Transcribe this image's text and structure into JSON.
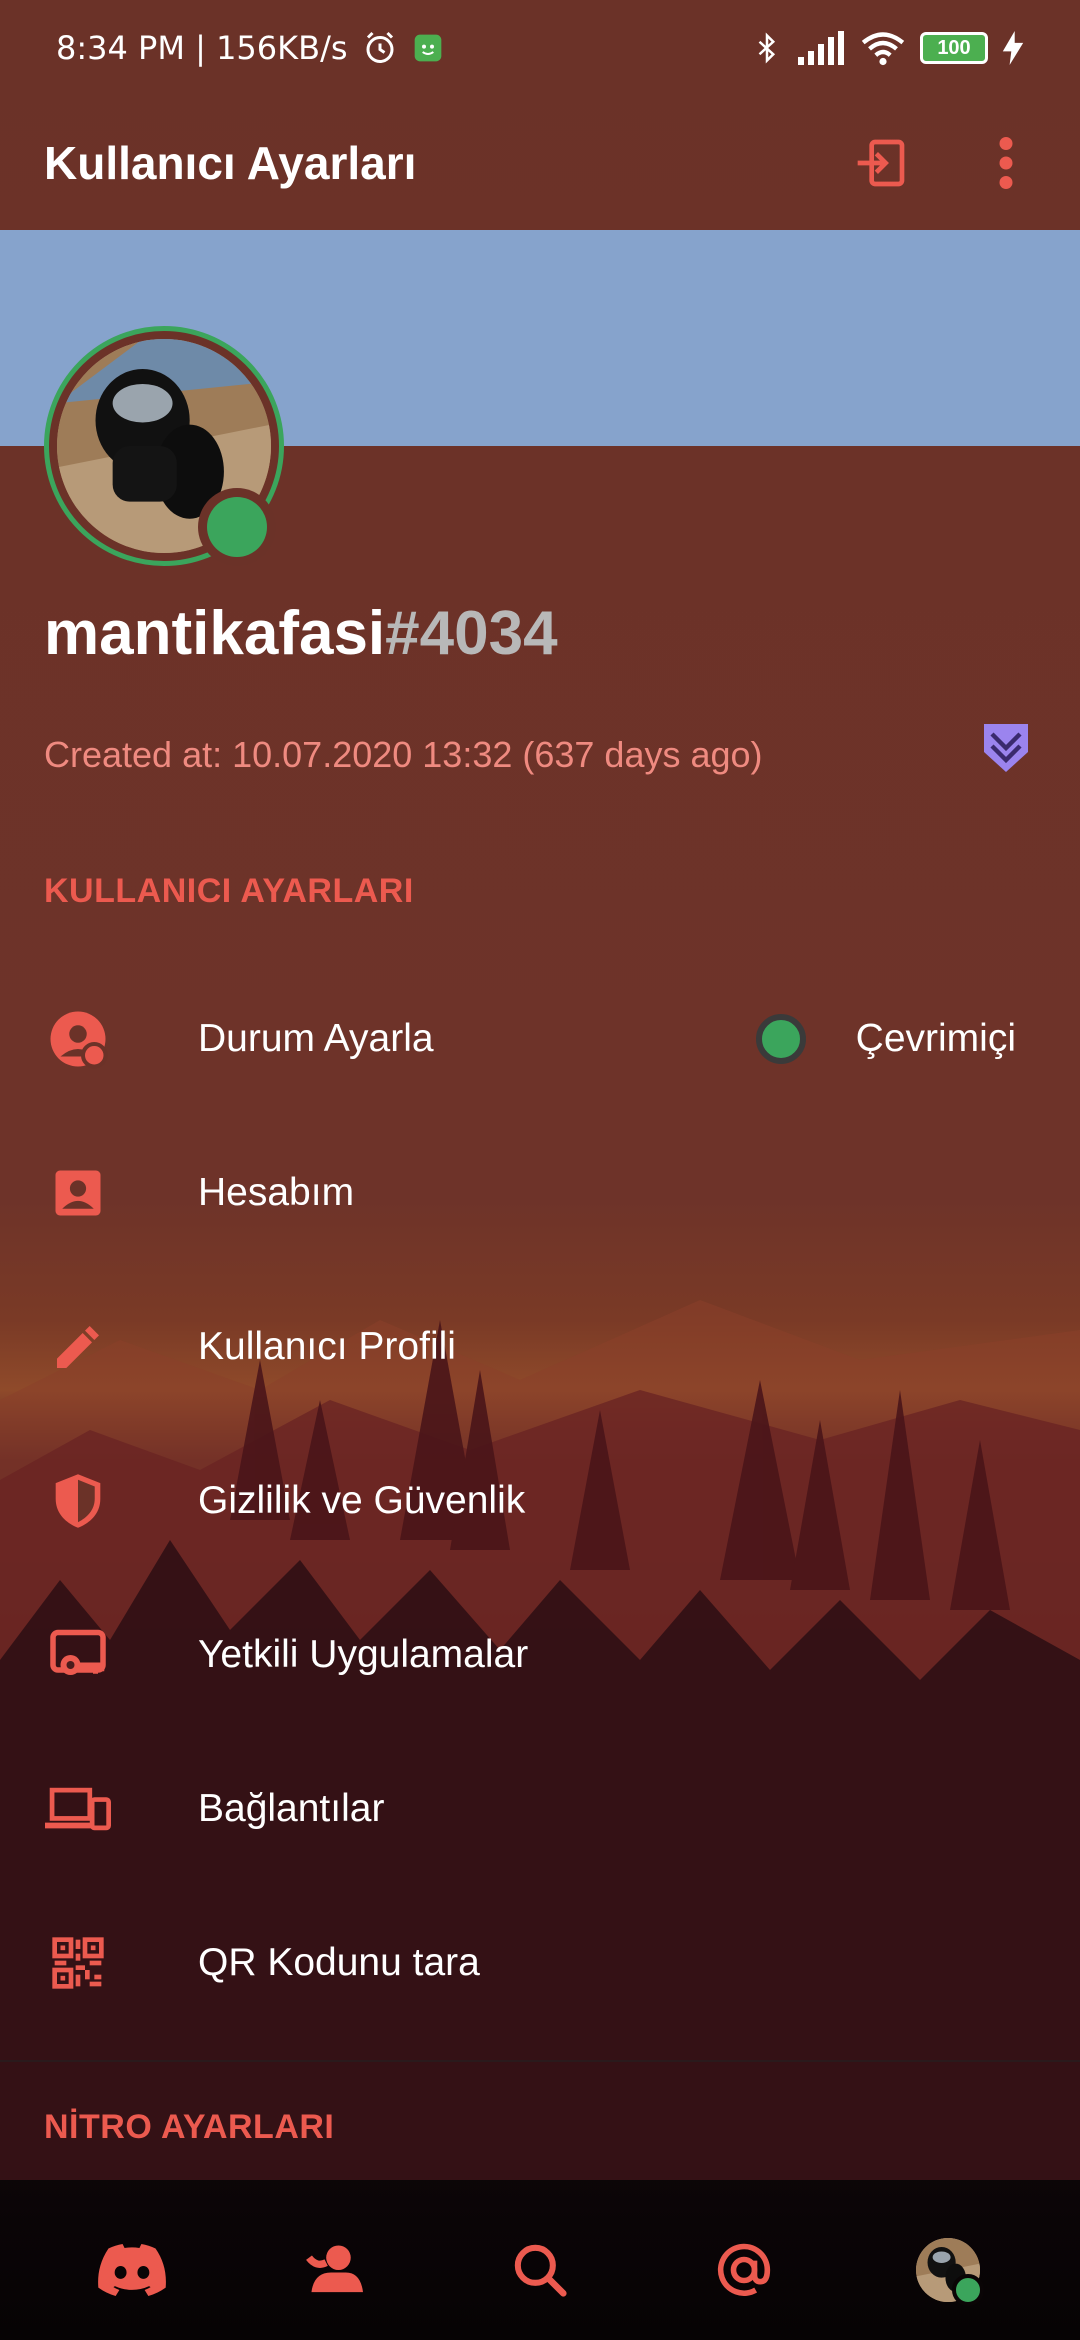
{
  "status_bar": {
    "time_speed": "8:34 PM | 156KB/s",
    "battery": "100"
  },
  "app_bar": {
    "title": "Kullanıcı Ayarları",
    "logout_icon": "logout-icon",
    "more_icon": "more-vert-icon"
  },
  "profile": {
    "username": "mantikafasi",
    "discriminator": "#4034",
    "created_at": "Created at: 10.07.2020 13:32 (637 days ago)",
    "status_color": "#3ba55c"
  },
  "user_settings": {
    "header": "KULLANICI AYARLARI",
    "items": [
      {
        "label": "Durum Ayarla",
        "icon": "status-face-icon",
        "value": "Çevrimiçi"
      },
      {
        "label": "Hesabım",
        "icon": "account-icon"
      },
      {
        "label": "Kullanıcı Profili",
        "icon": "pencil-icon"
      },
      {
        "label": "Gizlilik ve Güvenlik",
        "icon": "shield-icon"
      },
      {
        "label": "Yetkili Uygulamalar",
        "icon": "authorized-apps-icon"
      },
      {
        "label": "Bağlantılar",
        "icon": "devices-icon"
      },
      {
        "label": "QR Kodunu tara",
        "icon": "qr-code-icon"
      }
    ]
  },
  "nitro_settings": {
    "header": "NİTRO AYARLARI"
  },
  "bottom_nav": {
    "items": [
      "discord-home-icon",
      "friends-icon",
      "search-icon",
      "mentions-icon",
      "profile-avatar"
    ]
  },
  "colors": {
    "accent": "#ec5a4f",
    "online": "#3ba55c",
    "banner": "#86a3cc",
    "background": "#6b3228"
  }
}
